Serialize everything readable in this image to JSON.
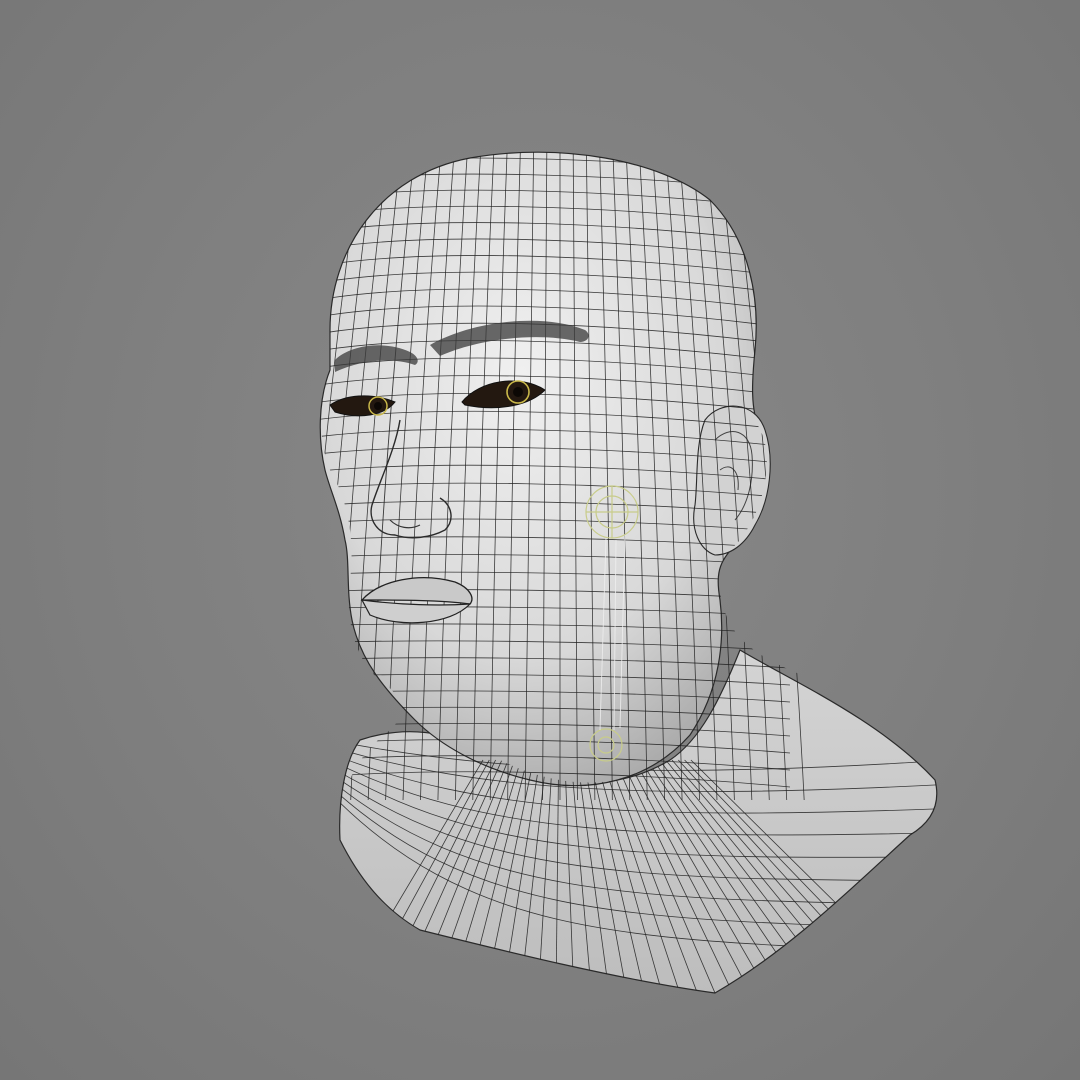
{
  "viewport": {
    "background_color": "#7f7f7f",
    "render_mode": "wireframe-on-shaded",
    "content": "bust"
  },
  "mesh": {
    "surface_color": "#d9d9d9",
    "wire_color": "#1e1e1e",
    "shadow_color": "#8c8c8c"
  },
  "eyes": {
    "iris_color": "#2a1a12",
    "highlight_ring_color": "#c9b84a"
  },
  "rig": {
    "gizmo_color": "#c8cc8a",
    "guide_line_color": "#f0f0f0"
  }
}
